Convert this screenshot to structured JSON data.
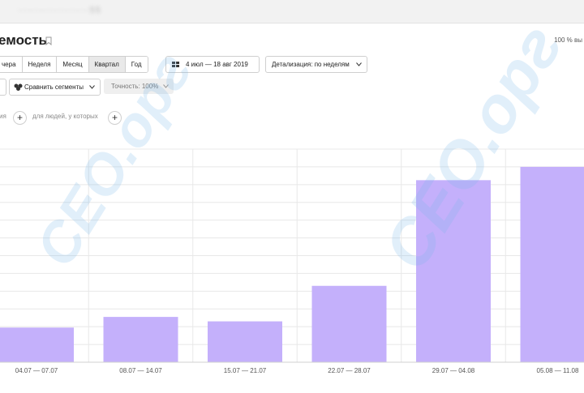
{
  "topbar": {
    "blurred_url": "···················55"
  },
  "header": {
    "title": "емость",
    "scale": "100 % вы"
  },
  "periods": [
    {
      "label": "чера",
      "active": false
    },
    {
      "label": "Неделя",
      "active": false
    },
    {
      "label": "Месяц",
      "active": false
    },
    {
      "label": "Квартал",
      "active": true
    },
    {
      "label": "Год",
      "active": false
    }
  ],
  "date_range": "4 июл — 18 авг 2019",
  "detail": "Детализация: по неделям",
  "compare": "Сравнить сегменты",
  "accuracy": "Точность: 100%",
  "conditions": {
    "part1": "ия",
    "plus": "+",
    "part2": "для людей, у которых"
  },
  "watermark": {
    "text_a": "CEO.орг",
    "text_b": "CEO.орг"
  },
  "colors": {
    "bar": "#c4b0fb",
    "grid": "#e8e8e8",
    "text": "#555555"
  },
  "chart_data": {
    "type": "bar",
    "categories": [
      "04.07 — 07.07",
      "08.07 — 14.07",
      "15.07 — 21.07",
      "22.07 — 28.07",
      "29.07 — 04.08",
      "05.08 — 11.08"
    ],
    "values": [
      39,
      51,
      46,
      86,
      205,
      220
    ],
    "ylim": [
      0,
      240
    ],
    "grid": true,
    "title": "",
    "xlabel": "",
    "ylabel": ""
  }
}
